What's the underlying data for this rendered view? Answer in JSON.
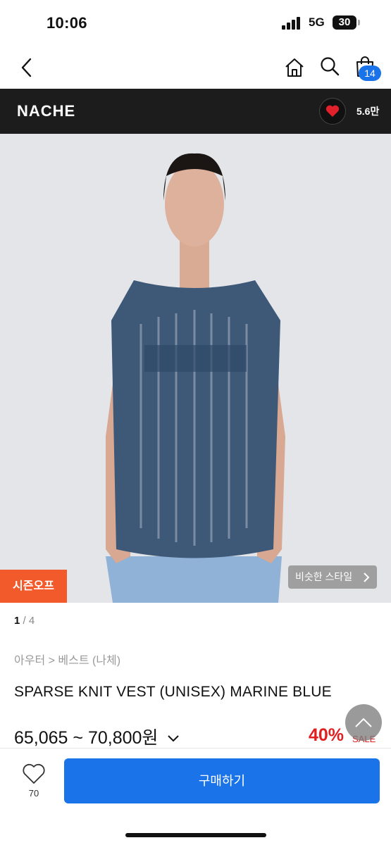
{
  "status_bar": {
    "time": "10:06",
    "network": "5G",
    "battery": "30"
  },
  "nav": {
    "cart_count": "14"
  },
  "brand": {
    "name": "NACHE",
    "like_count": "5.6만"
  },
  "image": {
    "season_badge": "시즌오프",
    "similar_label": "비슷한 스타일"
  },
  "pager": {
    "current": "1",
    "separator": " / ",
    "total": "4"
  },
  "breadcrumb": "아우터 > 베스트 (나체)",
  "product": {
    "title": "SPARSE KNIT VEST (UNISEX) MARINE BLUE",
    "price": "65,065 ~ 70,800원",
    "discount": "40%",
    "sale_label": "SALE"
  },
  "bottom": {
    "wish_count": "70",
    "buy_label": "구매하기"
  },
  "colors": {
    "accent": "#1a73e8",
    "season_badge": "#f25a2c",
    "discount": "#e02020",
    "brand_bar": "#1c1c1c"
  },
  "icons": [
    "back-icon",
    "home-icon",
    "search-icon",
    "shopping-bag-icon",
    "heart-icon",
    "chevron-right-icon",
    "chevron-down-icon",
    "chevron-up-icon",
    "heart-outline-icon"
  ]
}
